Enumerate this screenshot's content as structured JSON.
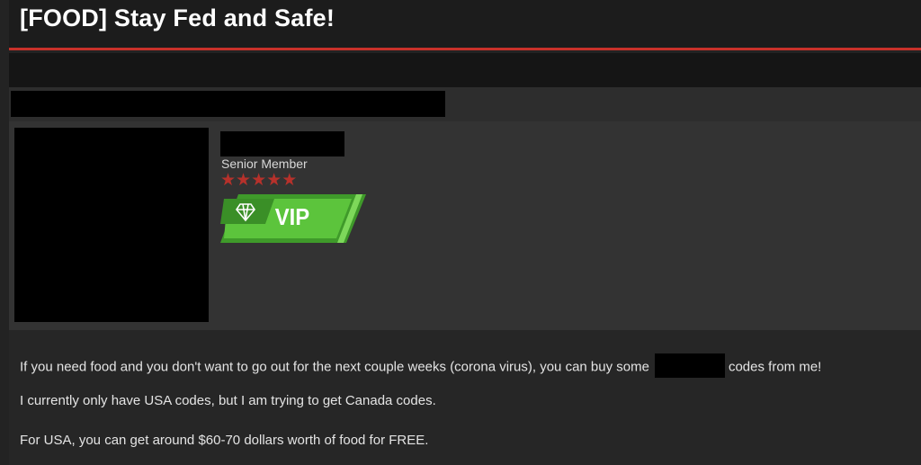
{
  "thread": {
    "title": "[FOOD] Stay Fed and Safe!"
  },
  "author": {
    "rank": "Senior Member",
    "star_count": 5,
    "badge_label": "VIP"
  },
  "post": {
    "line1_before": "If you need food and you don't want to go out for the next couple weeks (corona virus), you can buy some",
    "line1_after": "codes from me!",
    "line2": "I currently only have USA codes, but I am trying to get Canada codes.",
    "line3": "For USA, you can get around $60-70 dollars worth of food for FREE."
  },
  "colors": {
    "accent_red": "#c8312a",
    "star_red": "#b6312b",
    "vip_green": "#5cc43c"
  },
  "icons": {
    "star": "star-icon",
    "diamond": "diamond-icon"
  }
}
